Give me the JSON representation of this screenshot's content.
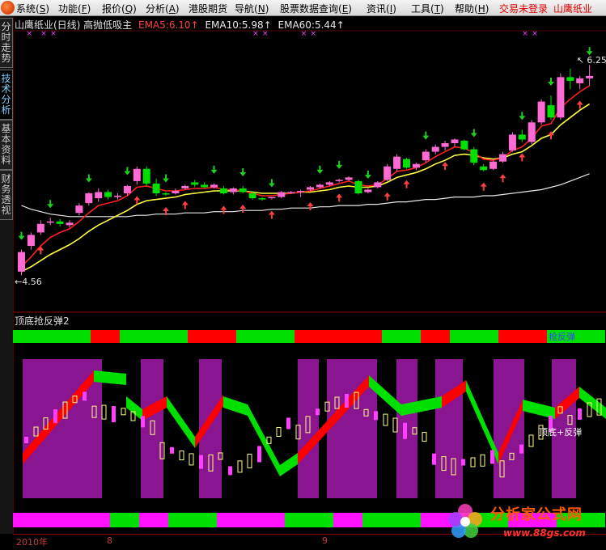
{
  "menu": [
    {
      "label": "系统",
      "key": "S"
    },
    {
      "label": "功能",
      "key": "F"
    },
    {
      "label": "报价",
      "key": "Q"
    },
    {
      "label": "分析",
      "key": "A"
    },
    {
      "label": "港股期货",
      "key": ""
    },
    {
      "label": "导航",
      "key": "N"
    },
    {
      "label": "股票数据查询",
      "key": "E"
    },
    {
      "label": "资讯",
      "key": "I"
    },
    {
      "label": "工具",
      "key": "T"
    },
    {
      "label": "帮助",
      "key": "H"
    }
  ],
  "menu_extra": [
    "交易未登录",
    "山鹰纸业"
  ],
  "side_tabs": [
    {
      "label": "分时走势",
      "active": false
    },
    {
      "label": "技术分析",
      "active": true
    },
    {
      "label": "基本资料",
      "active": false
    },
    {
      "label": "财务透视",
      "active": false
    }
  ],
  "main_chart": {
    "stock_title": "山鹰纸业(日线) 高抛低吸主",
    "ema5": "EMA5:6.10↑",
    "ema10": "EMA10:5.98↑",
    "ema60": "EMA60:5.44↑",
    "high_label": "6.25",
    "low_label": "4.56"
  },
  "sub_chart": {
    "title": "顶底抢反弹2",
    "bar_label": "抢反弹",
    "annotation": "顶底+反弹"
  },
  "footer": {
    "year": "2010年",
    "m1": "8",
    "m2": "9"
  },
  "watermark": {
    "title": "分析家公式网",
    "url": "www.88gs.com"
  },
  "colors": {
    "up": "#ff6ad5",
    "down": "#00e000",
    "ema5": "#ff2020",
    "ema10": "#ffff40",
    "ema60": "#e8e8e8",
    "band_red": "#ff0000",
    "band_green": "#00e000",
    "band_magenta": "#ff10ff",
    "purple": "#8a1590"
  },
  "chart_data": {
    "type": "candlestick",
    "title": "山鹰纸业(日线) 高抛低吸主",
    "ylim": [
      4.4,
      6.45
    ],
    "ohlc": [
      [
        4.56,
        4.74,
        4.53,
        4.72
      ],
      [
        4.77,
        4.88,
        4.74,
        4.86
      ],
      [
        4.88,
        4.98,
        4.86,
        4.95
      ],
      [
        4.96,
        5.0,
        4.94,
        4.97
      ],
      [
        4.97,
        4.99,
        4.93,
        4.95
      ],
      [
        4.94,
        4.98,
        4.92,
        4.96
      ],
      [
        5.04,
        5.12,
        5.02,
        5.1
      ],
      [
        5.12,
        5.21,
        5.1,
        5.2
      ],
      [
        5.16,
        5.24,
        5.13,
        5.21
      ],
      [
        5.21,
        5.23,
        5.15,
        5.17
      ],
      [
        5.17,
        5.2,
        5.15,
        5.18
      ],
      [
        5.2,
        5.27,
        5.18,
        5.26
      ],
      [
        5.3,
        5.42,
        5.27,
        5.4
      ],
      [
        5.4,
        5.42,
        5.26,
        5.28
      ],
      [
        5.28,
        5.32,
        5.18,
        5.2
      ],
      [
        5.2,
        5.21,
        5.18,
        5.19
      ],
      [
        5.2,
        5.24,
        5.19,
        5.22
      ],
      [
        5.24,
        5.27,
        5.23,
        5.26
      ],
      [
        5.29,
        5.31,
        5.25,
        5.27
      ],
      [
        5.27,
        5.29,
        5.24,
        5.25
      ],
      [
        5.25,
        5.28,
        5.24,
        5.27
      ],
      [
        5.24,
        5.26,
        5.19,
        5.2
      ],
      [
        5.21,
        5.25,
        5.19,
        5.24
      ],
      [
        5.24,
        5.26,
        5.2,
        5.21
      ],
      [
        5.2,
        5.22,
        5.15,
        5.16
      ],
      [
        5.16,
        5.17,
        5.14,
        5.15
      ],
      [
        5.16,
        5.17,
        5.15,
        5.17
      ],
      [
        5.17,
        5.22,
        5.16,
        5.21
      ],
      [
        5.21,
        5.22,
        5.2,
        5.21
      ],
      [
        5.21,
        5.23,
        5.17,
        5.22
      ],
      [
        5.23,
        5.26,
        5.22,
        5.25
      ],
      [
        5.25,
        5.28,
        5.24,
        5.27
      ],
      [
        5.27,
        5.3,
        5.26,
        5.29
      ],
      [
        5.3,
        5.32,
        5.29,
        5.31
      ],
      [
        5.31,
        5.34,
        5.3,
        5.33
      ],
      [
        5.3,
        5.31,
        5.19,
        5.2
      ],
      [
        5.21,
        5.24,
        5.2,
        5.23
      ],
      [
        5.25,
        5.3,
        5.24,
        5.29
      ],
      [
        5.31,
        5.44,
        5.3,
        5.42
      ],
      [
        5.4,
        5.52,
        5.38,
        5.5
      ],
      [
        5.48,
        5.49,
        5.4,
        5.41
      ],
      [
        5.41,
        5.45,
        5.39,
        5.44
      ],
      [
        5.47,
        5.56,
        5.45,
        5.54
      ],
      [
        5.54,
        5.6,
        5.52,
        5.58
      ],
      [
        5.58,
        5.63,
        5.55,
        5.61
      ],
      [
        5.61,
        5.65,
        5.58,
        5.64
      ],
      [
        5.63,
        5.64,
        5.55,
        5.56
      ],
      [
        5.56,
        5.58,
        5.43,
        5.45
      ],
      [
        5.42,
        5.44,
        5.38,
        5.39
      ],
      [
        5.4,
        5.47,
        5.39,
        5.46
      ],
      [
        5.46,
        5.54,
        5.45,
        5.52
      ],
      [
        5.55,
        5.7,
        5.54,
        5.68
      ],
      [
        5.68,
        5.72,
        5.62,
        5.64
      ],
      [
        5.62,
        5.8,
        5.6,
        5.78
      ],
      [
        5.78,
        5.97,
        5.76,
        5.95
      ],
      [
        5.92,
        6.0,
        5.8,
        5.82
      ],
      [
        5.82,
        6.18,
        5.8,
        6.15
      ],
      [
        6.15,
        6.22,
        6.05,
        6.12
      ],
      [
        6.1,
        6.16,
        6.05,
        6.14
      ],
      [
        6.14,
        6.25,
        6.08,
        6.16
      ]
    ],
    "ema5": [
      4.6,
      4.68,
      4.77,
      4.84,
      4.88,
      4.91,
      4.97,
      5.04,
      5.1,
      5.12,
      5.14,
      5.18,
      5.25,
      5.26,
      5.24,
      5.22,
      5.22,
      5.23,
      5.24,
      5.24,
      5.25,
      5.23,
      5.23,
      5.22,
      5.2,
      5.18,
      5.18,
      5.19,
      5.2,
      5.21,
      5.22,
      5.24,
      5.26,
      5.28,
      5.3,
      5.27,
      5.26,
      5.27,
      5.32,
      5.38,
      5.39,
      5.41,
      5.45,
      5.5,
      5.54,
      5.58,
      5.57,
      5.53,
      5.48,
      5.47,
      5.49,
      5.55,
      5.58,
      5.65,
      5.75,
      5.77,
      5.9,
      5.97,
      6.03,
      6.08
    ],
    "ema10": [
      4.56,
      4.6,
      4.65,
      4.7,
      4.74,
      4.78,
      4.83,
      4.89,
      4.94,
      4.98,
      5.02,
      5.06,
      5.11,
      5.14,
      5.15,
      5.16,
      5.17,
      5.19,
      5.2,
      5.21,
      5.22,
      5.22,
      5.22,
      5.22,
      5.21,
      5.2,
      5.2,
      5.2,
      5.2,
      5.21,
      5.21,
      5.22,
      5.23,
      5.25,
      5.26,
      5.25,
      5.25,
      5.26,
      5.29,
      5.33,
      5.35,
      5.37,
      5.4,
      5.44,
      5.47,
      5.51,
      5.52,
      5.51,
      5.49,
      5.48,
      5.49,
      5.52,
      5.54,
      5.59,
      5.65,
      5.68,
      5.76,
      5.82,
      5.88,
      5.93
    ],
    "ema60": [
      5.1,
      5.07,
      5.05,
      5.03,
      5.02,
      5.01,
      5.01,
      5.01,
      5.01,
      5.01,
      5.01,
      5.01,
      5.02,
      5.02,
      5.03,
      5.03,
      5.03,
      5.04,
      5.04,
      5.04,
      5.05,
      5.05,
      5.05,
      5.06,
      5.06,
      5.06,
      5.07,
      5.07,
      5.08,
      5.08,
      5.08,
      5.09,
      5.09,
      5.1,
      5.1,
      5.1,
      5.11,
      5.11,
      5.12,
      5.13,
      5.13,
      5.14,
      5.15,
      5.15,
      5.16,
      5.17,
      5.17,
      5.17,
      5.18,
      5.18,
      5.19,
      5.2,
      5.21,
      5.22,
      5.23,
      5.25,
      5.27,
      5.3,
      5.33,
      5.36
    ],
    "up_arrows": [
      2,
      12,
      15,
      17,
      21,
      23,
      26,
      30,
      33,
      38,
      40,
      44,
      48,
      50,
      52,
      55,
      58
    ],
    "down_arrows": [
      0,
      3,
      7,
      11,
      15,
      20,
      23,
      26,
      31,
      33,
      36,
      42,
      47,
      52,
      55,
      59
    ],
    "sub_up_bricks": [
      [
        0,
        3
      ],
      [
        3,
        5
      ]
    ]
  }
}
